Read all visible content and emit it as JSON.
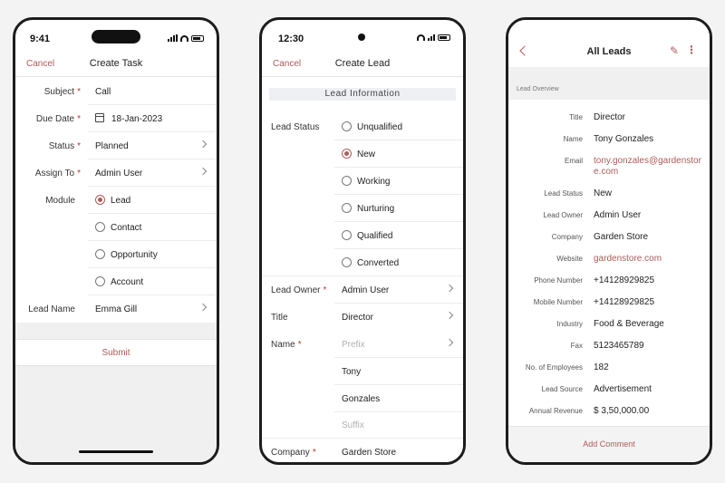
{
  "colors": {
    "accent": "#b05a5a",
    "required": "#c0392b",
    "background": "#f3f3f3"
  },
  "task": {
    "status_time": "9:41",
    "cancel": "Cancel",
    "title": "Create Task",
    "fields": [
      {
        "label": "Subject",
        "value": "Call"
      },
      {
        "label": "Due Date",
        "value": "18-Jan-2023"
      },
      {
        "label": "Status",
        "value": "Planned"
      },
      {
        "label": "Assign To",
        "value": "Admin User"
      }
    ],
    "module_label": "Module",
    "modules": [
      "Lead",
      "Contact",
      "Opportunity",
      "Account"
    ],
    "selected_module": "Lead",
    "lead_name_label": "Lead Name",
    "lead_name_value": "Emma Gill",
    "submit": "Submit"
  },
  "lead": {
    "status_time": "12:30",
    "cancel": "Cancel",
    "title": "Create Lead",
    "section": "Lead Information",
    "status_label": "Lead Status",
    "statuses": [
      "Unqualified",
      "New",
      "Working",
      "Nurturing",
      "Qualified",
      "Converted"
    ],
    "selected_status": "New",
    "owner_label": "Lead Owner",
    "owner_value": "Admin User",
    "title_label": "Title",
    "title_value": "Director",
    "name_label": "Name",
    "name_prefix_placeholder": "Prefix",
    "first_name": "Tony",
    "last_name": "Gonzales",
    "name_suffix_placeholder": "Suffix",
    "company_label": "Company",
    "company_value": "Garden Store"
  },
  "all_leads": {
    "title": "All Leads",
    "overview": "Lead Overview",
    "details": [
      {
        "label": "Title",
        "value": "Director"
      },
      {
        "label": "Name",
        "value": "Tony Gonzales"
      },
      {
        "label": "Email",
        "value": "tony.gonzales@gardenstore.com"
      },
      {
        "label": "Lead Status",
        "value": "New"
      },
      {
        "label": "Lead Owner",
        "value": "Admin User"
      },
      {
        "label": "Company",
        "value": "Garden Store"
      },
      {
        "label": "Website",
        "value": "gardenstore.com"
      },
      {
        "label": "Phone Number",
        "value": "+14128929825"
      },
      {
        "label": "Mobile Number",
        "value": "+14128929825"
      },
      {
        "label": "Industry",
        "value": "Food & Beverage"
      },
      {
        "label": "Fax",
        "value": "5123465789"
      },
      {
        "label": "No. of Employees",
        "value": "182"
      },
      {
        "label": "Lead Source",
        "value": "Advertisement"
      },
      {
        "label": "Annual Revenue",
        "value": "$ 3,50,000.00"
      }
    ],
    "add_comment": "Add Comment"
  }
}
